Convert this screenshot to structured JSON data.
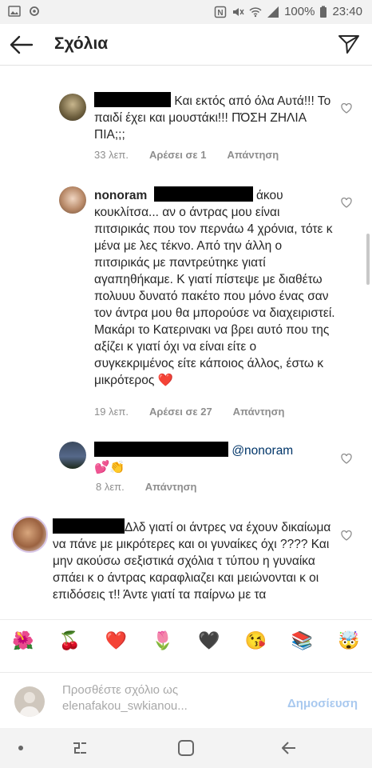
{
  "status_bar": {
    "battery": "100%",
    "time": "23:40"
  },
  "header": {
    "title": "Σχόλια",
    "icons": [
      "back-arrow-icon",
      "direct-send-icon"
    ]
  },
  "comments": [
    {
      "text": "Και εκτός από όλα Αυτά!!! Το παιδί έχει και μουστάκι!!! ΠΌΣΗ ΖΗΛΙΑ ΠΙΑ;;;",
      "time": "33 λεπ.",
      "likes": "Αρέσει σε 1",
      "reply": "Απάντηση"
    },
    {
      "username": "nonoram",
      "text": "άκου κουκλίτσα... αν ο άντρας μου είναι πιτσιρικάς που τον περνάω 4 χρόνια, τότε κ μένα με λες τέκνο. Από την άλλη ο πιτσιρικάς με παντρεύτηκε γιατί αγαπηθήκαμε. Κ γιατί πίστεψε με διαθέτω πολυυυ δυνατό πακέτο που μόνο ένας σαν τον άντρα μου θα μπορούσε να διαχειριστεί. Μακάρι το Κατερινακι να βρει αυτό που της αξίζει κ γιατί όχι να είναι είτε ο συγκεκριμένος είτε κάποιος άλλος, έστω κ μικρότερος",
      "emoji": "❤️",
      "time": "19 λεπ.",
      "likes": "Αρέσει σε 27",
      "reply": "Απάντηση"
    },
    {
      "mention": "@nonoram",
      "emoji": "💕👏",
      "time": "8 λεπ.",
      "reply": "Απάντηση"
    },
    {
      "text": "Δλδ γιατί οι άντρες να έχουν δικαίωμα να πάνε με μικρότερες και οι γυναίκες όχι ???? Και μην ακούσω σεξιστικά σχόλια τ τύπου η γυναίκα σπάει κ ο άντρας καραφλιαζει και μειώνονται κ οι επιδόσεις τ!! Άντε γιατί τα παίρνω με τα"
    }
  ],
  "emoji_bar": [
    "🌺",
    "🍒",
    "❤️",
    "🌷",
    "🖤",
    "😘",
    "📚",
    "🤯"
  ],
  "composer": {
    "placeholder_line1": "Προσθέστε σχόλιο ως",
    "placeholder_line2": "elenafakou_swkianou...",
    "post_label": "Δημοσίευση"
  },
  "nav_icons": [
    "dot-icon",
    "recents-icon",
    "home-icon",
    "back-icon"
  ]
}
